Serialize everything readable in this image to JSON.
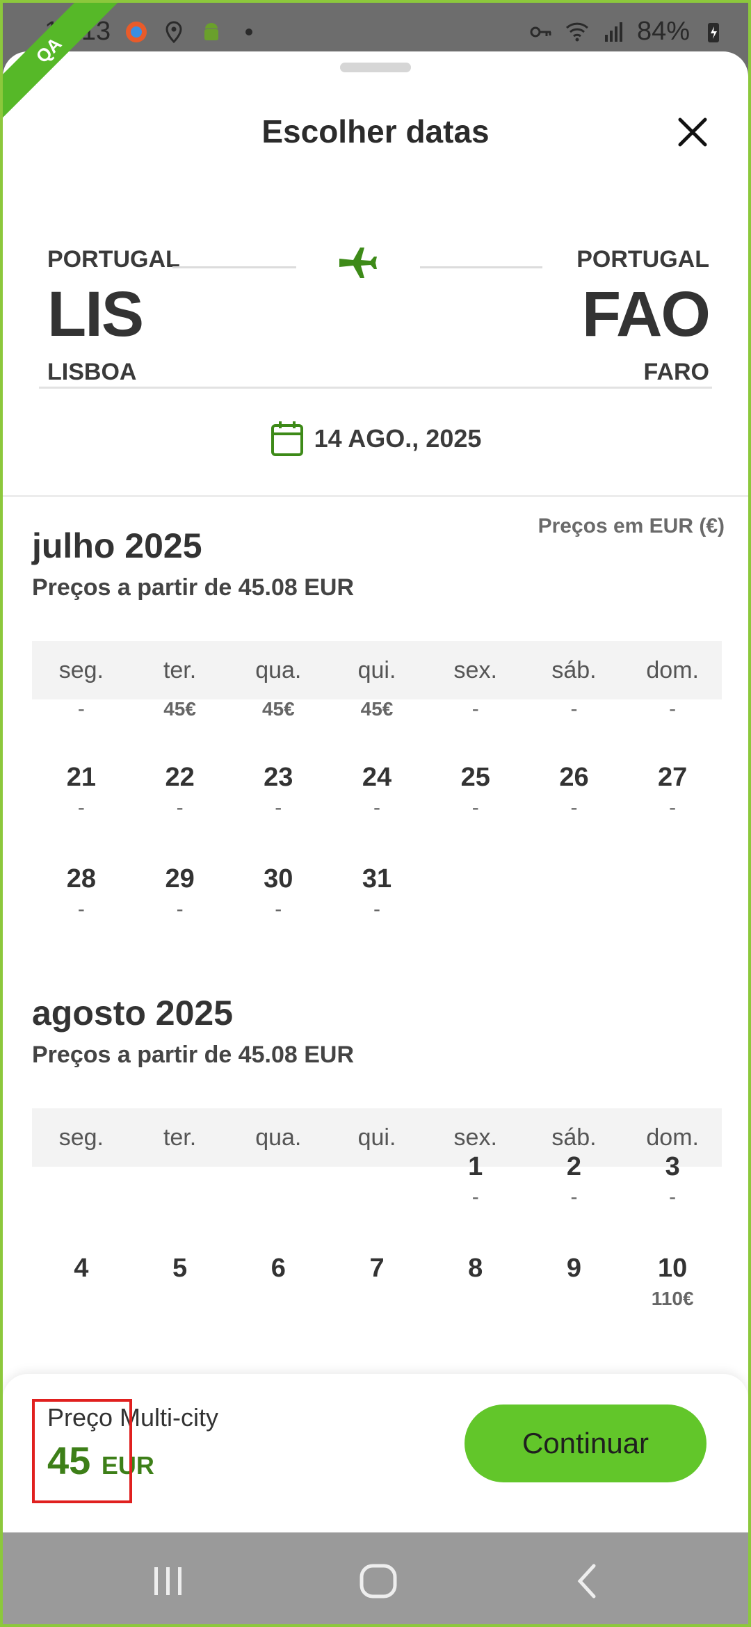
{
  "status_bar": {
    "time": "17:13",
    "battery": "84%",
    "qa_badge": "QA"
  },
  "sheet": {
    "title": "Escolher datas",
    "route": {
      "origin": {
        "country": "PORTUGAL",
        "code": "LIS",
        "city": "LISBOA"
      },
      "destination": {
        "country": "PORTUGAL",
        "code": "FAO",
        "city": "FARO"
      }
    },
    "selected_date": "14 AGO., 2025",
    "price_note": "Preços em EUR (€)",
    "weekdays": [
      "seg.",
      "ter.",
      "qua.",
      "qui.",
      "sex.",
      "sáb.",
      "dom."
    ],
    "months": [
      {
        "title": "julho 2025",
        "subtitle": "Preços a partir de 45.08 EUR",
        "rows": [
          [
            {
              "day": "",
              "price": "-"
            },
            {
              "day": "",
              "price": "45€"
            },
            {
              "day": "",
              "price": "45€"
            },
            {
              "day": "",
              "price": "45€"
            },
            {
              "day": "",
              "price": "-"
            },
            {
              "day": "",
              "price": "-"
            },
            {
              "day": "",
              "price": "-"
            }
          ],
          [
            {
              "day": "21",
              "price": "-"
            },
            {
              "day": "22",
              "price": "-"
            },
            {
              "day": "23",
              "price": "-"
            },
            {
              "day": "24",
              "price": "-"
            },
            {
              "day": "25",
              "price": "-"
            },
            {
              "day": "26",
              "price": "-"
            },
            {
              "day": "27",
              "price": "-"
            }
          ],
          [
            {
              "day": "28",
              "price": "-"
            },
            {
              "day": "29",
              "price": "-"
            },
            {
              "day": "30",
              "price": "-"
            },
            {
              "day": "31",
              "price": "-"
            },
            {
              "day": "",
              "price": ""
            },
            {
              "day": "",
              "price": ""
            },
            {
              "day": "",
              "price": ""
            }
          ]
        ]
      },
      {
        "title": "agosto 2025",
        "subtitle": "Preços a partir de 45.08 EUR",
        "rows": [
          [
            {
              "day": "",
              "price": ""
            },
            {
              "day": "",
              "price": ""
            },
            {
              "day": "",
              "price": ""
            },
            {
              "day": "",
              "price": ""
            },
            {
              "day": "1",
              "price": "-"
            },
            {
              "day": "2",
              "price": "-"
            },
            {
              "day": "3",
              "price": "-"
            }
          ],
          [
            {
              "day": "4",
              "price": ""
            },
            {
              "day": "5",
              "price": ""
            },
            {
              "day": "6",
              "price": ""
            },
            {
              "day": "7",
              "price": ""
            },
            {
              "day": "8",
              "price": ""
            },
            {
              "day": "9",
              "price": ""
            },
            {
              "day": "10",
              "price": "110€"
            }
          ]
        ]
      }
    ]
  },
  "footer": {
    "label": "Preço Multi-city",
    "price_value": "45",
    "price_currency": "EUR",
    "continue_label": "Continuar"
  },
  "colors": {
    "brand_green": "#62c62a",
    "price_green": "#3d7f18",
    "highlight_red": "#e0201f"
  }
}
